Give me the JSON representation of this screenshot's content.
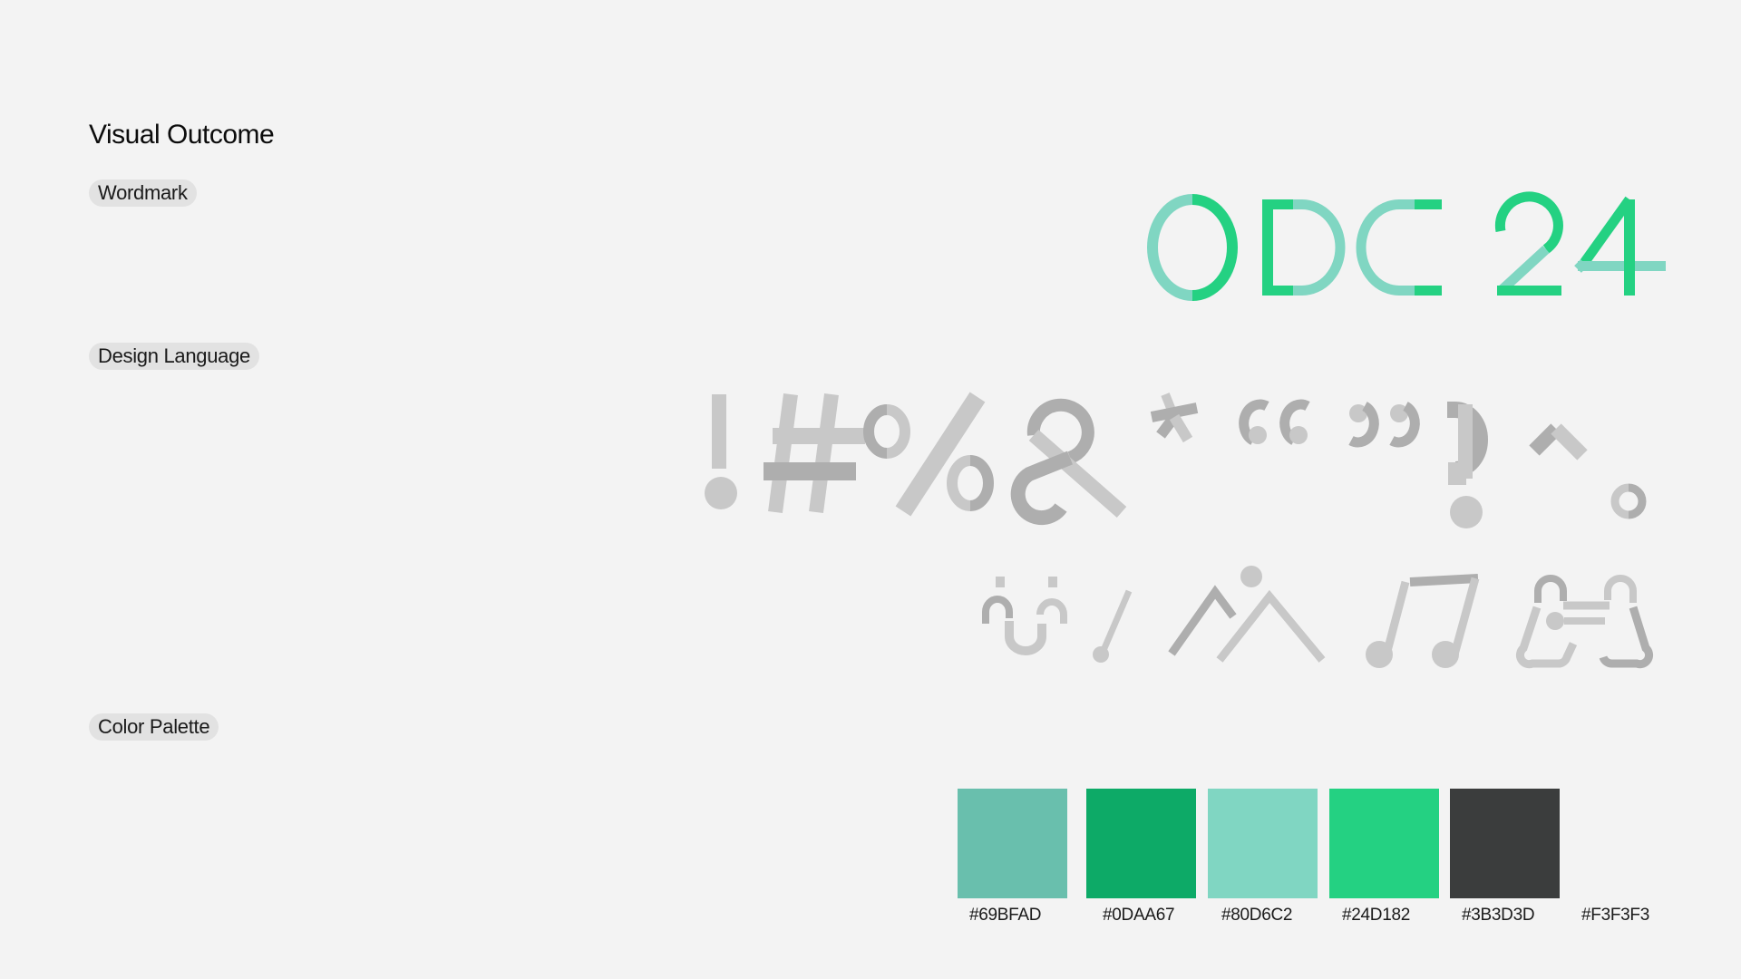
{
  "page": {
    "title": "Visual Outcome",
    "sections": {
      "wordmark": "Wordmark",
      "design_language": "Design Language",
      "color_palette": "Color Palette"
    }
  },
  "wordmark": {
    "text": "ODC 24",
    "colors": [
      "#80D6C2",
      "#24D182"
    ]
  },
  "design_language": {
    "symbols": [
      "!",
      "#",
      "%",
      "&",
      "*",
      "“",
      "”",
      "?",
      "^",
      "°"
    ],
    "icons": [
      "smiley-face-icon",
      "exclamation-icon",
      "mountains-icon",
      "music-note-icon",
      "game-controller-icon"
    ],
    "colors": [
      "#C8C8C8",
      "#AEAEAE"
    ]
  },
  "palette": {
    "swatches": [
      {
        "hex": "#69BFAD",
        "label": "#69BFAD"
      },
      {
        "hex": "#0DAA67",
        "label": "#0DAA67"
      },
      {
        "hex": "#80D6C2",
        "label": "#80D6C2"
      },
      {
        "hex": "#24D182",
        "label": "#24D182"
      },
      {
        "hex": "#3B3D3D",
        "label": "#3B3D3D"
      },
      {
        "hex": "#F3F3F3",
        "label": "#F3F3F3"
      }
    ]
  }
}
